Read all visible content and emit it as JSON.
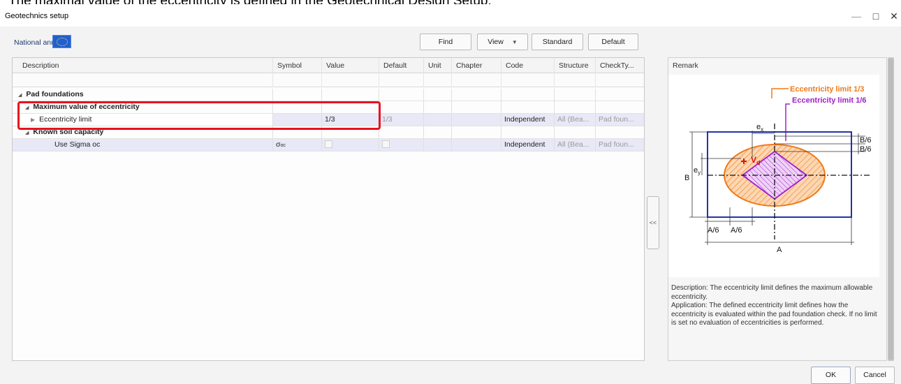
{
  "caption": "The maximal value of the eccentricity is defined in the Geotechnical Design Setup.",
  "window": {
    "title": "Geotechnics setup",
    "minimize": "—",
    "maximize": "□",
    "close": "✕"
  },
  "toolbar": {
    "national_annex_label": "National annex:",
    "flag_icon": "eu-flag-icon",
    "find_label": "Find",
    "view_label": "View",
    "standard_label": "Standard",
    "default_label": "Default"
  },
  "grid": {
    "columns": [
      "Description",
      "Symbol",
      "Value",
      "Default",
      "Unit",
      "Chapter",
      "Code",
      "Structure",
      "CheckTy..."
    ],
    "rows": {
      "pad": {
        "description": "Pad foundations"
      },
      "maxecc": {
        "description": "Maximum value of eccentricity"
      },
      "ecclimit": {
        "description": "Eccentricity limit",
        "value": "1/3",
        "default": "1/3",
        "code": "Independent",
        "structure": "All (Bea...",
        "checktype": "Pad foun..."
      },
      "soil": {
        "description": "Known soil capacity"
      },
      "sigma": {
        "description": "Use Sigma oc",
        "symbol_main": "σ",
        "symbol_sub": "oc",
        "code": "Independent",
        "structure": "All (Bea...",
        "checktype": "Pad foun..."
      }
    }
  },
  "collapse_label": "<<",
  "remark": {
    "title": "Remark",
    "diagram": {
      "legend_1_3": "Eccentricity limit 1/3",
      "legend_1_6": "Eccentricity limit 1/6",
      "ex": "e",
      "ex_sub": "x",
      "ey": "e",
      "ey_sub": "y",
      "vd": "V",
      "vd_sub": "d",
      "b6_top": "B/6",
      "b6_bottom": "B/6",
      "b_label": "B",
      "a6_left": "A/6",
      "a6_right": "A/6",
      "a_label": "A",
      "colors": {
        "outline": "#2233aa",
        "limit_1_3": "#f07a1a",
        "limit_1_6": "#a020c8",
        "load": "#e01010"
      }
    },
    "description": "Description: The eccentricity limit defines the maximum allowable eccentricity.",
    "application": "Application: The defined eccentricity limit defines how the eccentricity is evaluated within the pad foundation check. If no limit is set no evaluation of eccentricities is performed."
  },
  "buttons": {
    "ok": "OK",
    "cancel": "Cancel"
  }
}
